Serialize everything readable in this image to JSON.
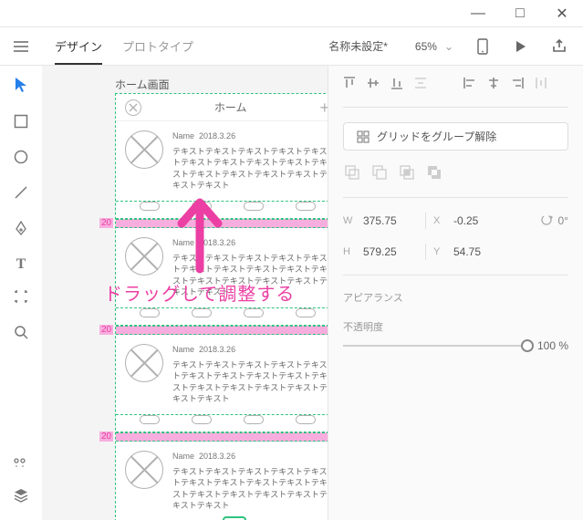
{
  "titlebar": {
    "minimize": "—",
    "maximize": "□",
    "close": "✕"
  },
  "header": {
    "tabs": {
      "design": "デザイン",
      "prototype": "プロトタイプ"
    },
    "docname": "名称未設定*",
    "zoom": "65%"
  },
  "canvas": {
    "artboard_label": "ホーム画面",
    "artboard_title": "ホーム",
    "gap_label": "20",
    "card": {
      "name_label": "Name",
      "date": "2018.3.26",
      "body": "テキストテキストテキストテキストテキストテキストテキストテキストテキストテキストテキストテキストテキストテキストテキストテキスト"
    },
    "instruction": "ドラッグして調整する"
  },
  "panel": {
    "ungroup_btn": "グリッドをグループ解除",
    "width_label": "W",
    "width": "375.75",
    "x_label": "X",
    "x": "-0.25",
    "height_label": "H",
    "height": "579.25",
    "y_label": "Y",
    "y": "54.75",
    "rotation": "0°",
    "appearance_label": "アピアランス",
    "opacity_label": "不透明度",
    "opacity_value": "100 %"
  }
}
